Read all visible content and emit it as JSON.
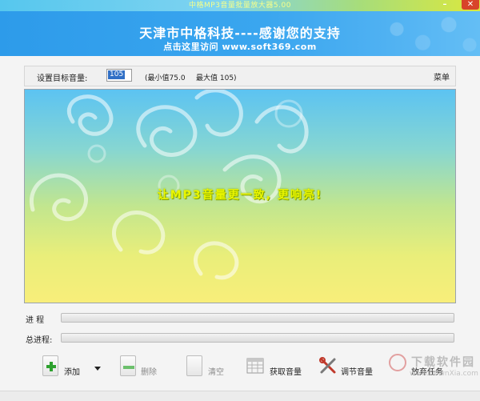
{
  "window": {
    "title": "中格MP3音量批量放大器5.00",
    "minimize_glyph": "–",
    "close_glyph": "✕"
  },
  "banner": {
    "line1": "天津市中格科技----感谢您的支持",
    "line2": "点击这里访问 www.soft369.com"
  },
  "settings": {
    "target_label": "设置目标音量:",
    "target_value": "105",
    "min_text": "(最小值75.0",
    "max_text": "最大值 105)",
    "menu_label": "菜单"
  },
  "main": {
    "slogan": "让MP3音量更一致, 更响亮!"
  },
  "progress": {
    "current_label": "进    程",
    "current_fraction": 0.0,
    "total_label": "总进程:",
    "total_fraction": 0.0
  },
  "toolbar": {
    "add_label": "添加",
    "delete_label": "删除",
    "clear_label": "清空",
    "get_volume_label": "获取音量",
    "adjust_volume_label": "调节音量",
    "abort_label": "放弃任务"
  },
  "watermark": {
    "text": "下载软件园",
    "url": "www.DownXia.com"
  },
  "colors": {
    "banner": "#2d9bea",
    "slogan": "#e9f500",
    "add_icon": "#2ea12f"
  }
}
